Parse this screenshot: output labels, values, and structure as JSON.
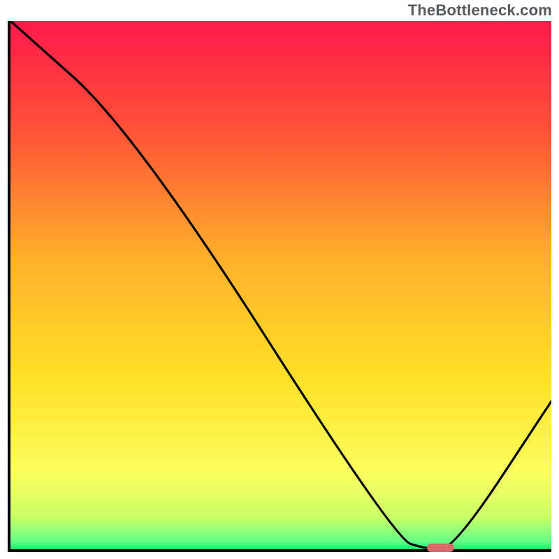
{
  "watermark": "TheBottleneck.com",
  "chart_data": {
    "type": "line",
    "title": "",
    "xlabel": "",
    "ylabel": "",
    "xlim": [
      0,
      100
    ],
    "ylim": [
      0,
      100
    ],
    "grid": false,
    "legend": false,
    "background": {
      "kind": "vertical-gradient",
      "stops": [
        {
          "pos": 0.0,
          "color": "#ff1a4b"
        },
        {
          "pos": 0.2,
          "color": "#ff5038"
        },
        {
          "pos": 0.45,
          "color": "#ffb02a"
        },
        {
          "pos": 0.68,
          "color": "#ffe127"
        },
        {
          "pos": 0.86,
          "color": "#fbff60"
        },
        {
          "pos": 0.94,
          "color": "#c9ff68"
        },
        {
          "pos": 0.985,
          "color": "#66ff87"
        },
        {
          "pos": 1.0,
          "color": "#1ee86f"
        }
      ]
    },
    "series": [
      {
        "name": "bottleneck-curve",
        "color": "#000000",
        "x": [
          0,
          23,
          71,
          77,
          82,
          100
        ],
        "y": [
          100,
          79,
          2,
          0,
          0,
          28
        ]
      }
    ],
    "marker": {
      "name": "optimal-range",
      "color": "#d86b6a",
      "x_start": 77,
      "x_end": 82,
      "y": 0
    }
  }
}
